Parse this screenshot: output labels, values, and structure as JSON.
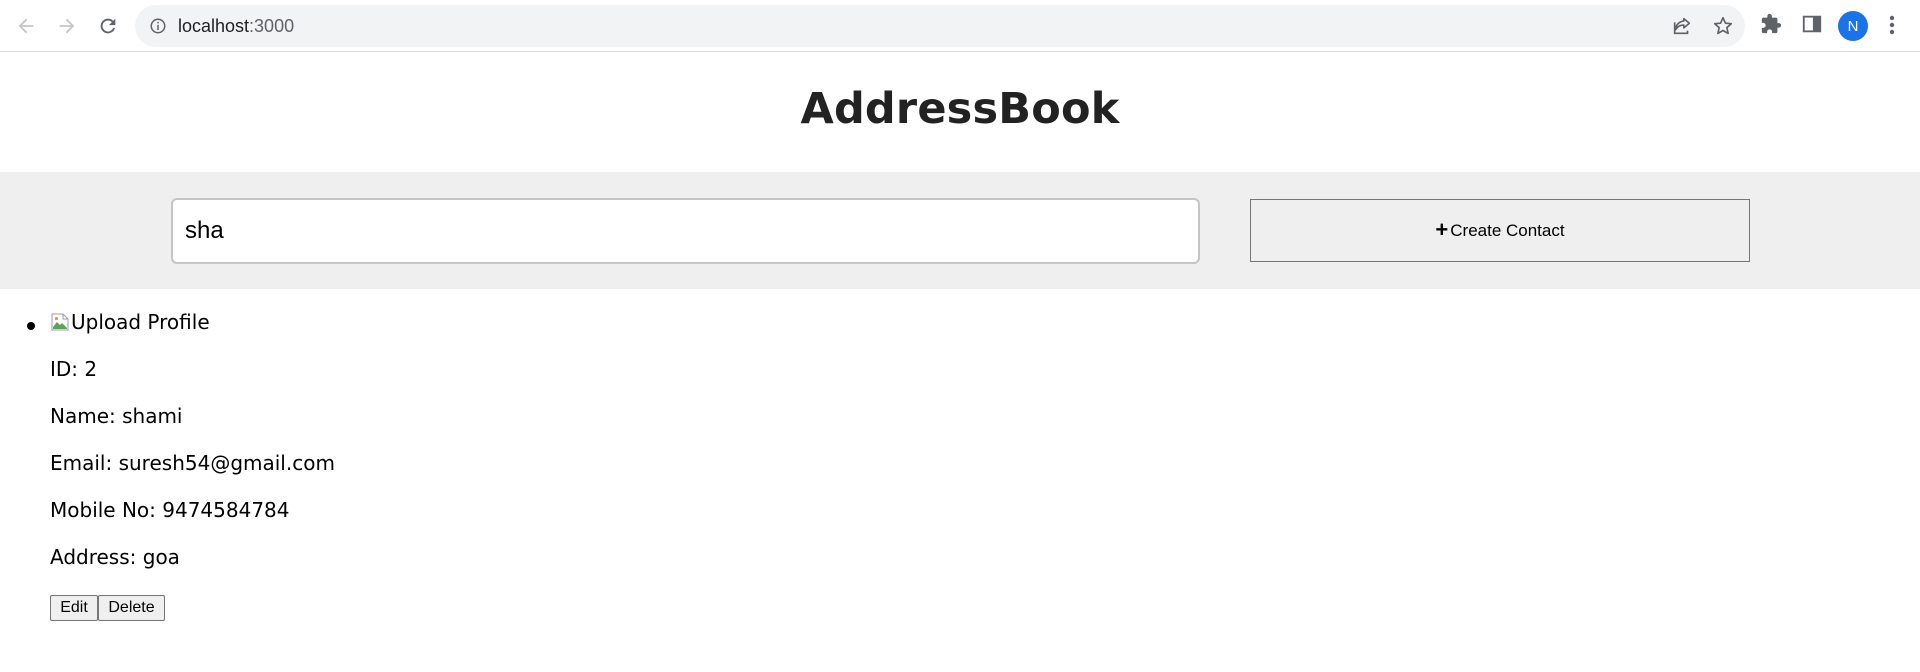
{
  "browser": {
    "url_host": "localhost",
    "url_port": ":3000",
    "profile_initial": "N",
    "icons": [
      "back-icon",
      "forward-icon",
      "reload-icon",
      "info-icon",
      "share-icon",
      "star-icon",
      "extensions-icon",
      "side-panel-icon",
      "kebab-menu-icon"
    ]
  },
  "page": {
    "title": "AddressBook"
  },
  "search": {
    "value": "sha",
    "placeholder": ""
  },
  "create_button": {
    "icon": "+",
    "label": "Create Contact"
  },
  "contacts": [
    {
      "image_alt": "Upload Profile",
      "id": "ID: 2",
      "name": "Name: shami",
      "email": "Email: suresh54@gmail.com",
      "mobile": "Mobile No: 9474584784",
      "address": "Address: goa",
      "edit_label": "Edit",
      "delete_label": "Delete"
    }
  ],
  "colors": {
    "band": "#efefef",
    "avatar": "#1a73e8",
    "title": "#222222"
  }
}
